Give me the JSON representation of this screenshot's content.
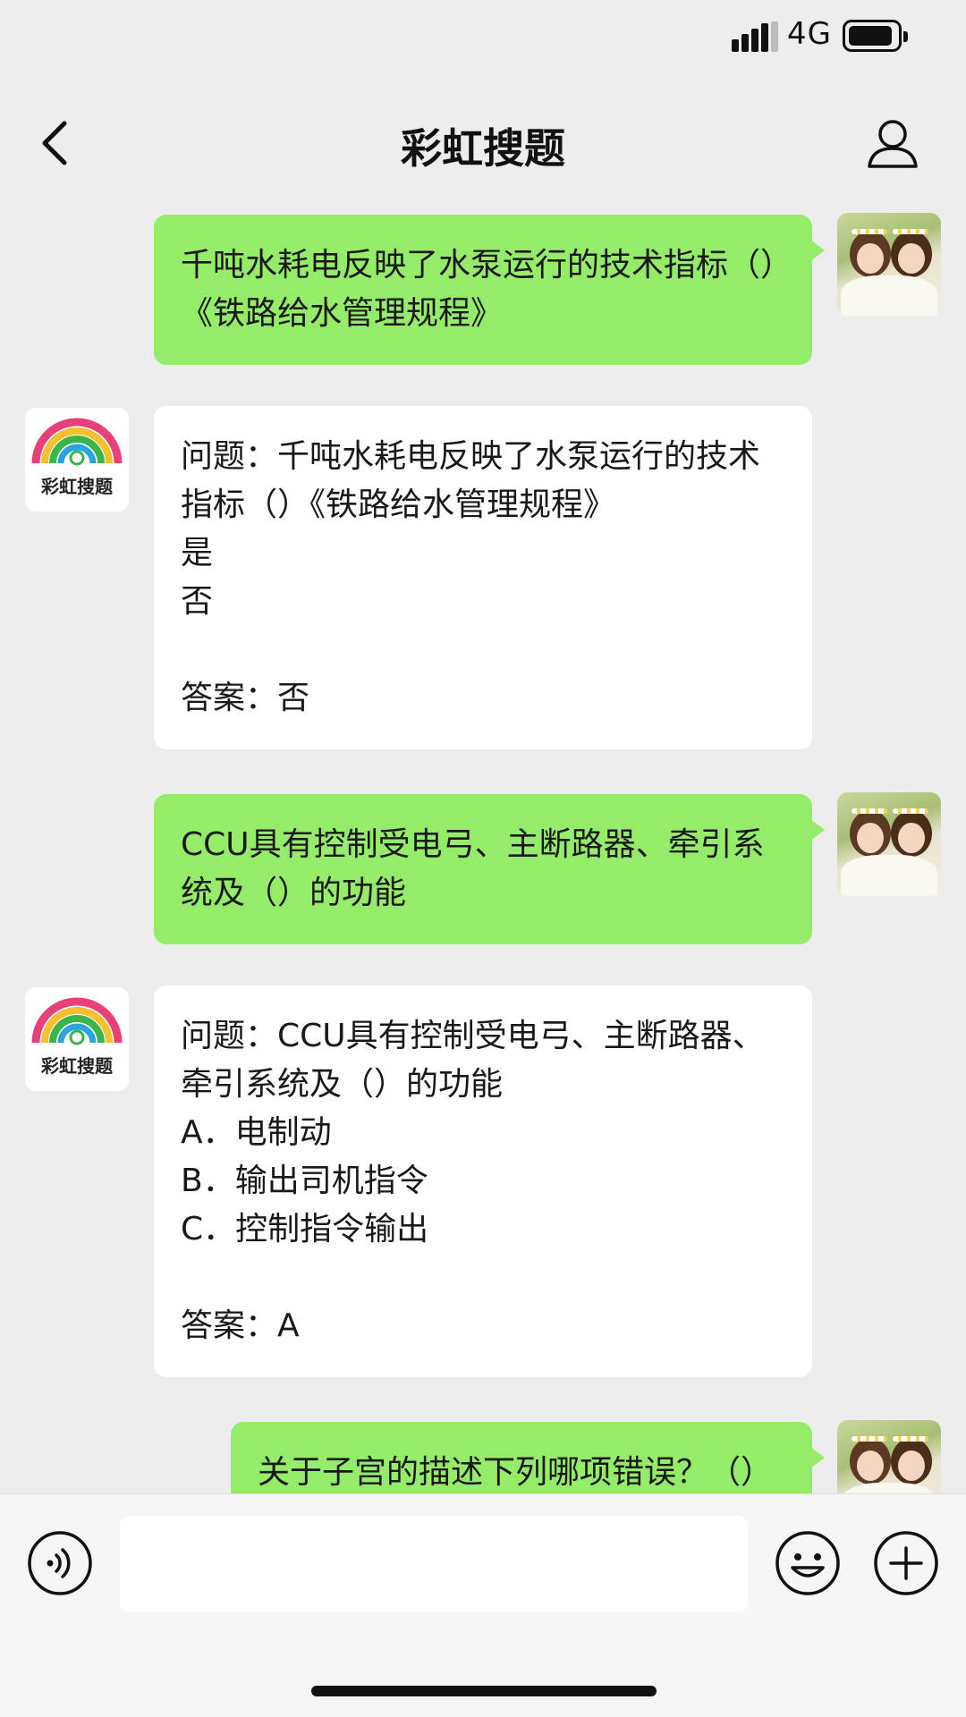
{
  "status_bar": {
    "network": "4G",
    "icons": [
      "signal-icon",
      "battery-icon"
    ]
  },
  "nav": {
    "title": "彩虹搜题",
    "back_icon": "chevron-left-icon",
    "profile_icon": "person-icon"
  },
  "messages": [
    {
      "side": "sent",
      "avatar": "photo-avatar",
      "text": "千吨水耗电反映了水泵运行的技术指标（）《铁路给水管理规程》"
    },
    {
      "side": "received",
      "avatar": "logo-avatar",
      "avatar_label": "彩虹搜题",
      "text": "问题：千吨水耗电反映了水泵运行的技术指标（）《铁路给水管理规程》\n是\n否\n\n答案：否"
    },
    {
      "side": "sent",
      "avatar": "photo-avatar",
      "text": "CCU具有控制受电弓、主断路器、牵引系统及（）的功能"
    },
    {
      "side": "received",
      "avatar": "logo-avatar",
      "avatar_label": "彩虹搜题",
      "text": "问题：CCU具有控制受电弓、主断路器、牵引系统及（）的功能\nA．电制动\nB．输出司机指令\nC．控制指令输出\n\n答案：A"
    },
    {
      "side": "sent",
      "avatar": "photo-avatar",
      "text": "关于子宫的描述下列哪项错误？（）"
    }
  ],
  "input_bar": {
    "placeholder": "",
    "value": "",
    "icons": [
      "voice-icon",
      "emoji-icon",
      "plus-icon"
    ]
  },
  "colors": {
    "background": "#ededed",
    "sent_bubble": "#95ec69",
    "received_bubble": "#ffffff"
  }
}
